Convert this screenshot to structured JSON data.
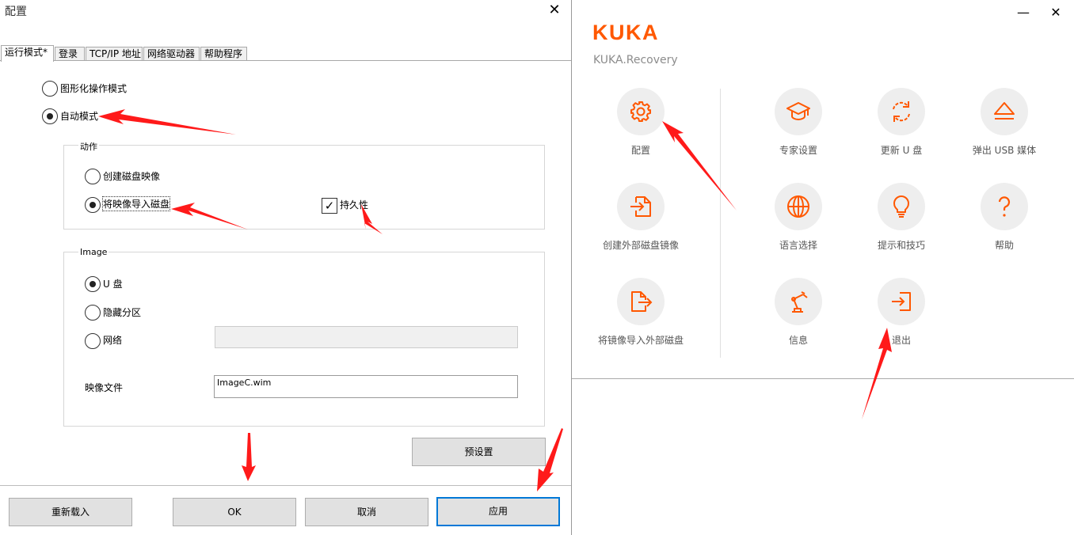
{
  "config_dialog": {
    "title": "配置",
    "close": "✕",
    "tabs": [
      {
        "label": "运行模式*"
      },
      {
        "label": "登录"
      },
      {
        "label": "TCP/IP 地址"
      },
      {
        "label": "网络驱动器"
      },
      {
        "label": "帮助程序"
      }
    ],
    "active_tab": "运行模式*",
    "mode_options": [
      {
        "label": "图形化操作模式",
        "checked": false
      },
      {
        "label": "自动模式",
        "checked": true
      }
    ],
    "action_group": {
      "title": "动作",
      "options": [
        {
          "label": "创建磁盘映像",
          "checked": false
        },
        {
          "label": "将映像导入磁盘",
          "checked": true
        }
      ],
      "persistence": {
        "label": "持久性",
        "checked": true,
        "mark": "✓"
      }
    },
    "image_group": {
      "title": "Image",
      "options": [
        {
          "label": "U 盘",
          "checked": true
        },
        {
          "label": "隐藏分区",
          "checked": false
        },
        {
          "label": "网络",
          "checked": false
        }
      ],
      "network_path": "",
      "image_file_label": "映像文件",
      "image_file_value": "ImageC.wim"
    },
    "preset_button": "预设置",
    "buttons": {
      "reload": "重新载入",
      "ok": "OK",
      "cancel": "取消",
      "apply": "应用"
    }
  },
  "recovery_window": {
    "logo": "KUKA",
    "subtitle": "KUKA.Recovery",
    "window_controls": {
      "minimize": "—",
      "close": "✕"
    },
    "accent_color": "#ff5800",
    "tiles": [
      {
        "label": "配置",
        "icon": "gear-icon"
      },
      {
        "label": "创建外部磁盘镜像",
        "icon": "import-document-icon"
      },
      {
        "label": "将镜像导入外部磁盘",
        "icon": "export-document-icon"
      },
      {
        "label": "专家设置",
        "icon": "graduation-cap-icon"
      },
      {
        "label": "更新 U 盘",
        "icon": "refresh-icon"
      },
      {
        "label": "弹出 USB 媒体",
        "icon": "eject-icon"
      },
      {
        "label": "语言选择",
        "icon": "globe-icon"
      },
      {
        "label": "提示和技巧",
        "icon": "lightbulb-icon"
      },
      {
        "label": "帮助",
        "icon": "question-icon"
      },
      {
        "label": "信息",
        "icon": "robot-arm-icon"
      },
      {
        "label": "退出",
        "icon": "exit-icon"
      }
    ]
  },
  "annotation_color": "#ff1a1a"
}
